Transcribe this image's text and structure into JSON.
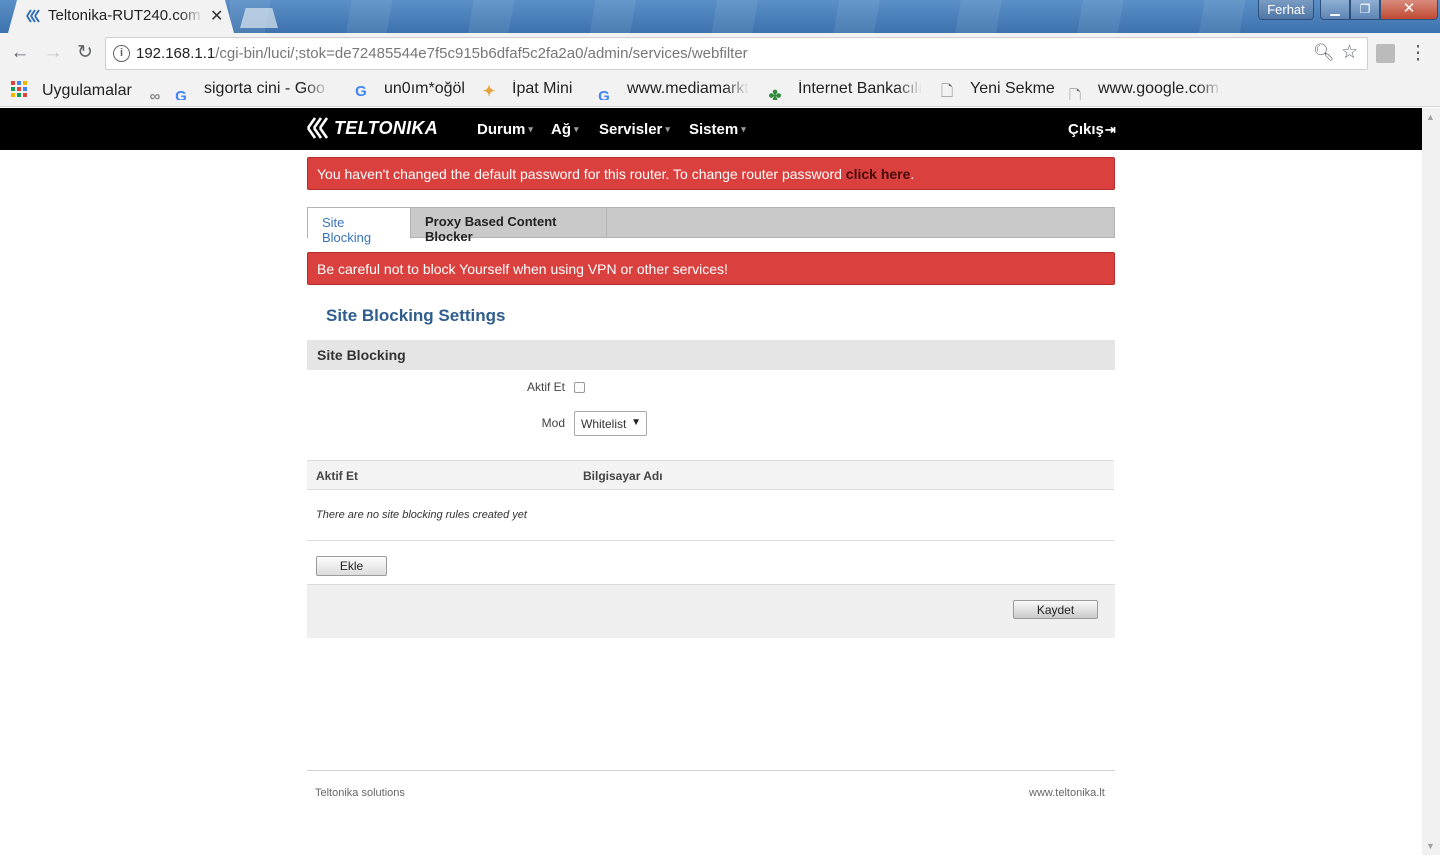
{
  "browser": {
    "tab_title": "Teltonika-RUT240.com",
    "tab_close": "✕",
    "window_user": "Ferhat",
    "url_host": "192.168.1.1",
    "url_path": "/cgi-bin/luci/;stok=de72485544e7f5c915b6dfaf5c2fa2a0/admin/services/webfilter",
    "bookmarks": [
      {
        "icon": "apps-grid-icon",
        "label": "Uygulamalar"
      },
      {
        "icon": "bookmark-glyph-icon",
        "label": "sigorta cini - Goo"
      },
      {
        "icon": "google-icon",
        "label": "un0ım*oğöl"
      },
      {
        "icon": "star-multicolor-icon",
        "label": "İpat Mini"
      },
      {
        "icon": "google-icon",
        "label": "www.mediamarkt"
      },
      {
        "icon": "clover-icon",
        "label": "İnternet Bankacılı"
      },
      {
        "icon": "page-icon",
        "label": "Yeni Sekme"
      },
      {
        "icon": "page-icon",
        "label": "www.google.com."
      }
    ]
  },
  "navbar": {
    "logo_text": "TELTONIKA",
    "menu": [
      "Durum",
      "Ağ",
      "Servisler",
      "Sistem"
    ],
    "logout": "Çıkış"
  },
  "alerts": {
    "password_text": "You haven't changed the default password for this router. To change router password ",
    "password_link": "click here",
    "password_end": ".",
    "vpn_warning": "Be careful not to block Yourself when using VPN or other services!"
  },
  "tabs": {
    "site_blocking": "Site Blocking",
    "proxy_blocker": "Proxy Based Content Blocker"
  },
  "settings": {
    "title": "Site Blocking Settings",
    "section_head": "Site Blocking",
    "enable_label": "Aktif Et",
    "mode_label": "Mod",
    "mode_value": "Whitelist"
  },
  "table": {
    "col_enable": "Aktif Et",
    "col_hostname": "Bilgisayar Adı",
    "empty": "There are no site blocking rules created yet"
  },
  "buttons": {
    "add": "Ekle",
    "save": "Kaydet"
  },
  "footer": {
    "left": "Teltonika solutions",
    "right": "www.teltonika.lt"
  },
  "colors": {
    "alert_red": "#d9403e",
    "title_blue": "#2f5e8e",
    "tab_active_blue": "#3a74b8",
    "navbar": "#000000"
  }
}
